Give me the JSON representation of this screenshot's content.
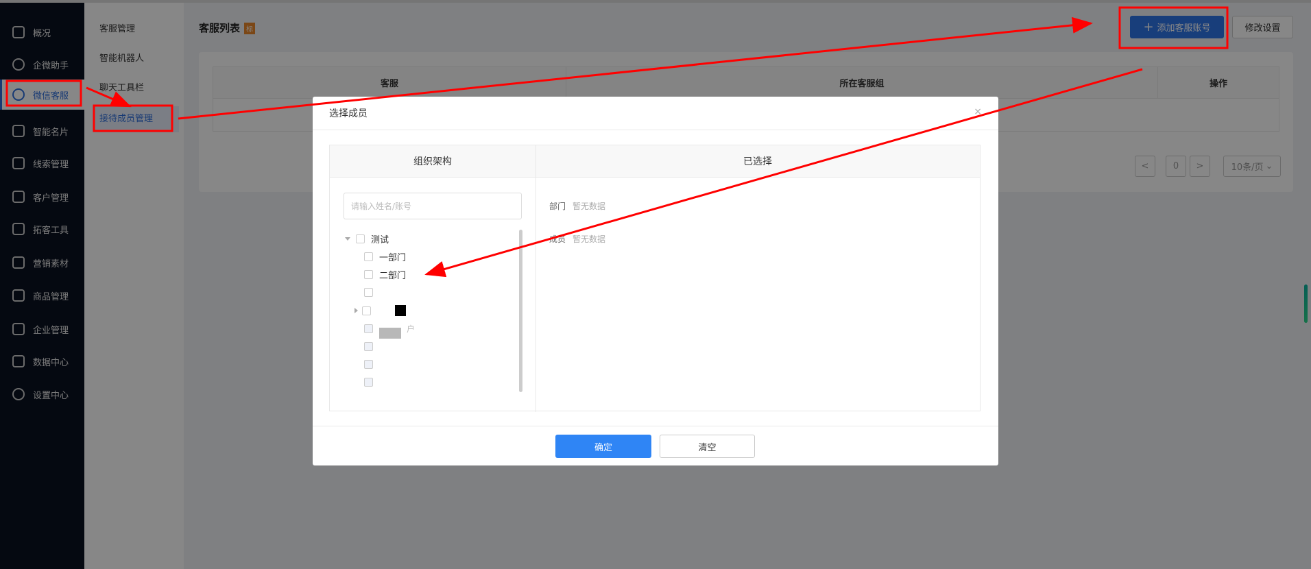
{
  "sidebar": {
    "items": [
      {
        "label": "概况",
        "icon": "home-icon"
      },
      {
        "label": "企微助手",
        "icon": "chat-icon"
      },
      {
        "label": "微信客服",
        "icon": "smile-chat-icon",
        "active": true
      },
      {
        "label": "智能名片",
        "icon": "card-icon"
      },
      {
        "label": "线索管理",
        "icon": "route-icon"
      },
      {
        "label": "客户管理",
        "icon": "users-icon"
      },
      {
        "label": "拓客工具",
        "icon": "handshake-icon"
      },
      {
        "label": "营销素材",
        "icon": "megaphone-icon"
      },
      {
        "label": "商品管理",
        "icon": "bag-icon"
      },
      {
        "label": "企业管理",
        "icon": "briefcase-icon"
      },
      {
        "label": "数据中心",
        "icon": "chart-icon"
      },
      {
        "label": "设置中心",
        "icon": "settings-icon"
      }
    ]
  },
  "submenu": {
    "items": [
      {
        "label": "客服管理"
      },
      {
        "label": "智能机器人"
      },
      {
        "label": "聊天工具栏"
      },
      {
        "label": "接待成员管理",
        "active": true
      }
    ]
  },
  "page": {
    "title": "客服列表",
    "tag": "标",
    "add_button": "添加客服账号",
    "modify_button": "修改设置",
    "columns": [
      "客服",
      "所在客服组",
      "操作"
    ],
    "pagination": {
      "prev": "<",
      "page": "0",
      "next": ">",
      "page_size": "10条/页"
    }
  },
  "modal": {
    "title": "选择成员",
    "close": "×",
    "left_header": "组织架构",
    "right_header": "已选择",
    "search_placeholder": "请输入姓名/账号",
    "tree": [
      {
        "label": "测试"
      },
      {
        "label": "一部门"
      },
      {
        "label": "二部门"
      }
    ],
    "partial_label": "户",
    "selected": {
      "dept_label": "部门",
      "dept_empty": "暂无数据",
      "member_label": "成员",
      "member_empty": "暂无数据"
    },
    "ok": "确定",
    "clear": "清空"
  },
  "colors": {
    "accent": "#2f75e8",
    "annotation": "#ff0000"
  }
}
